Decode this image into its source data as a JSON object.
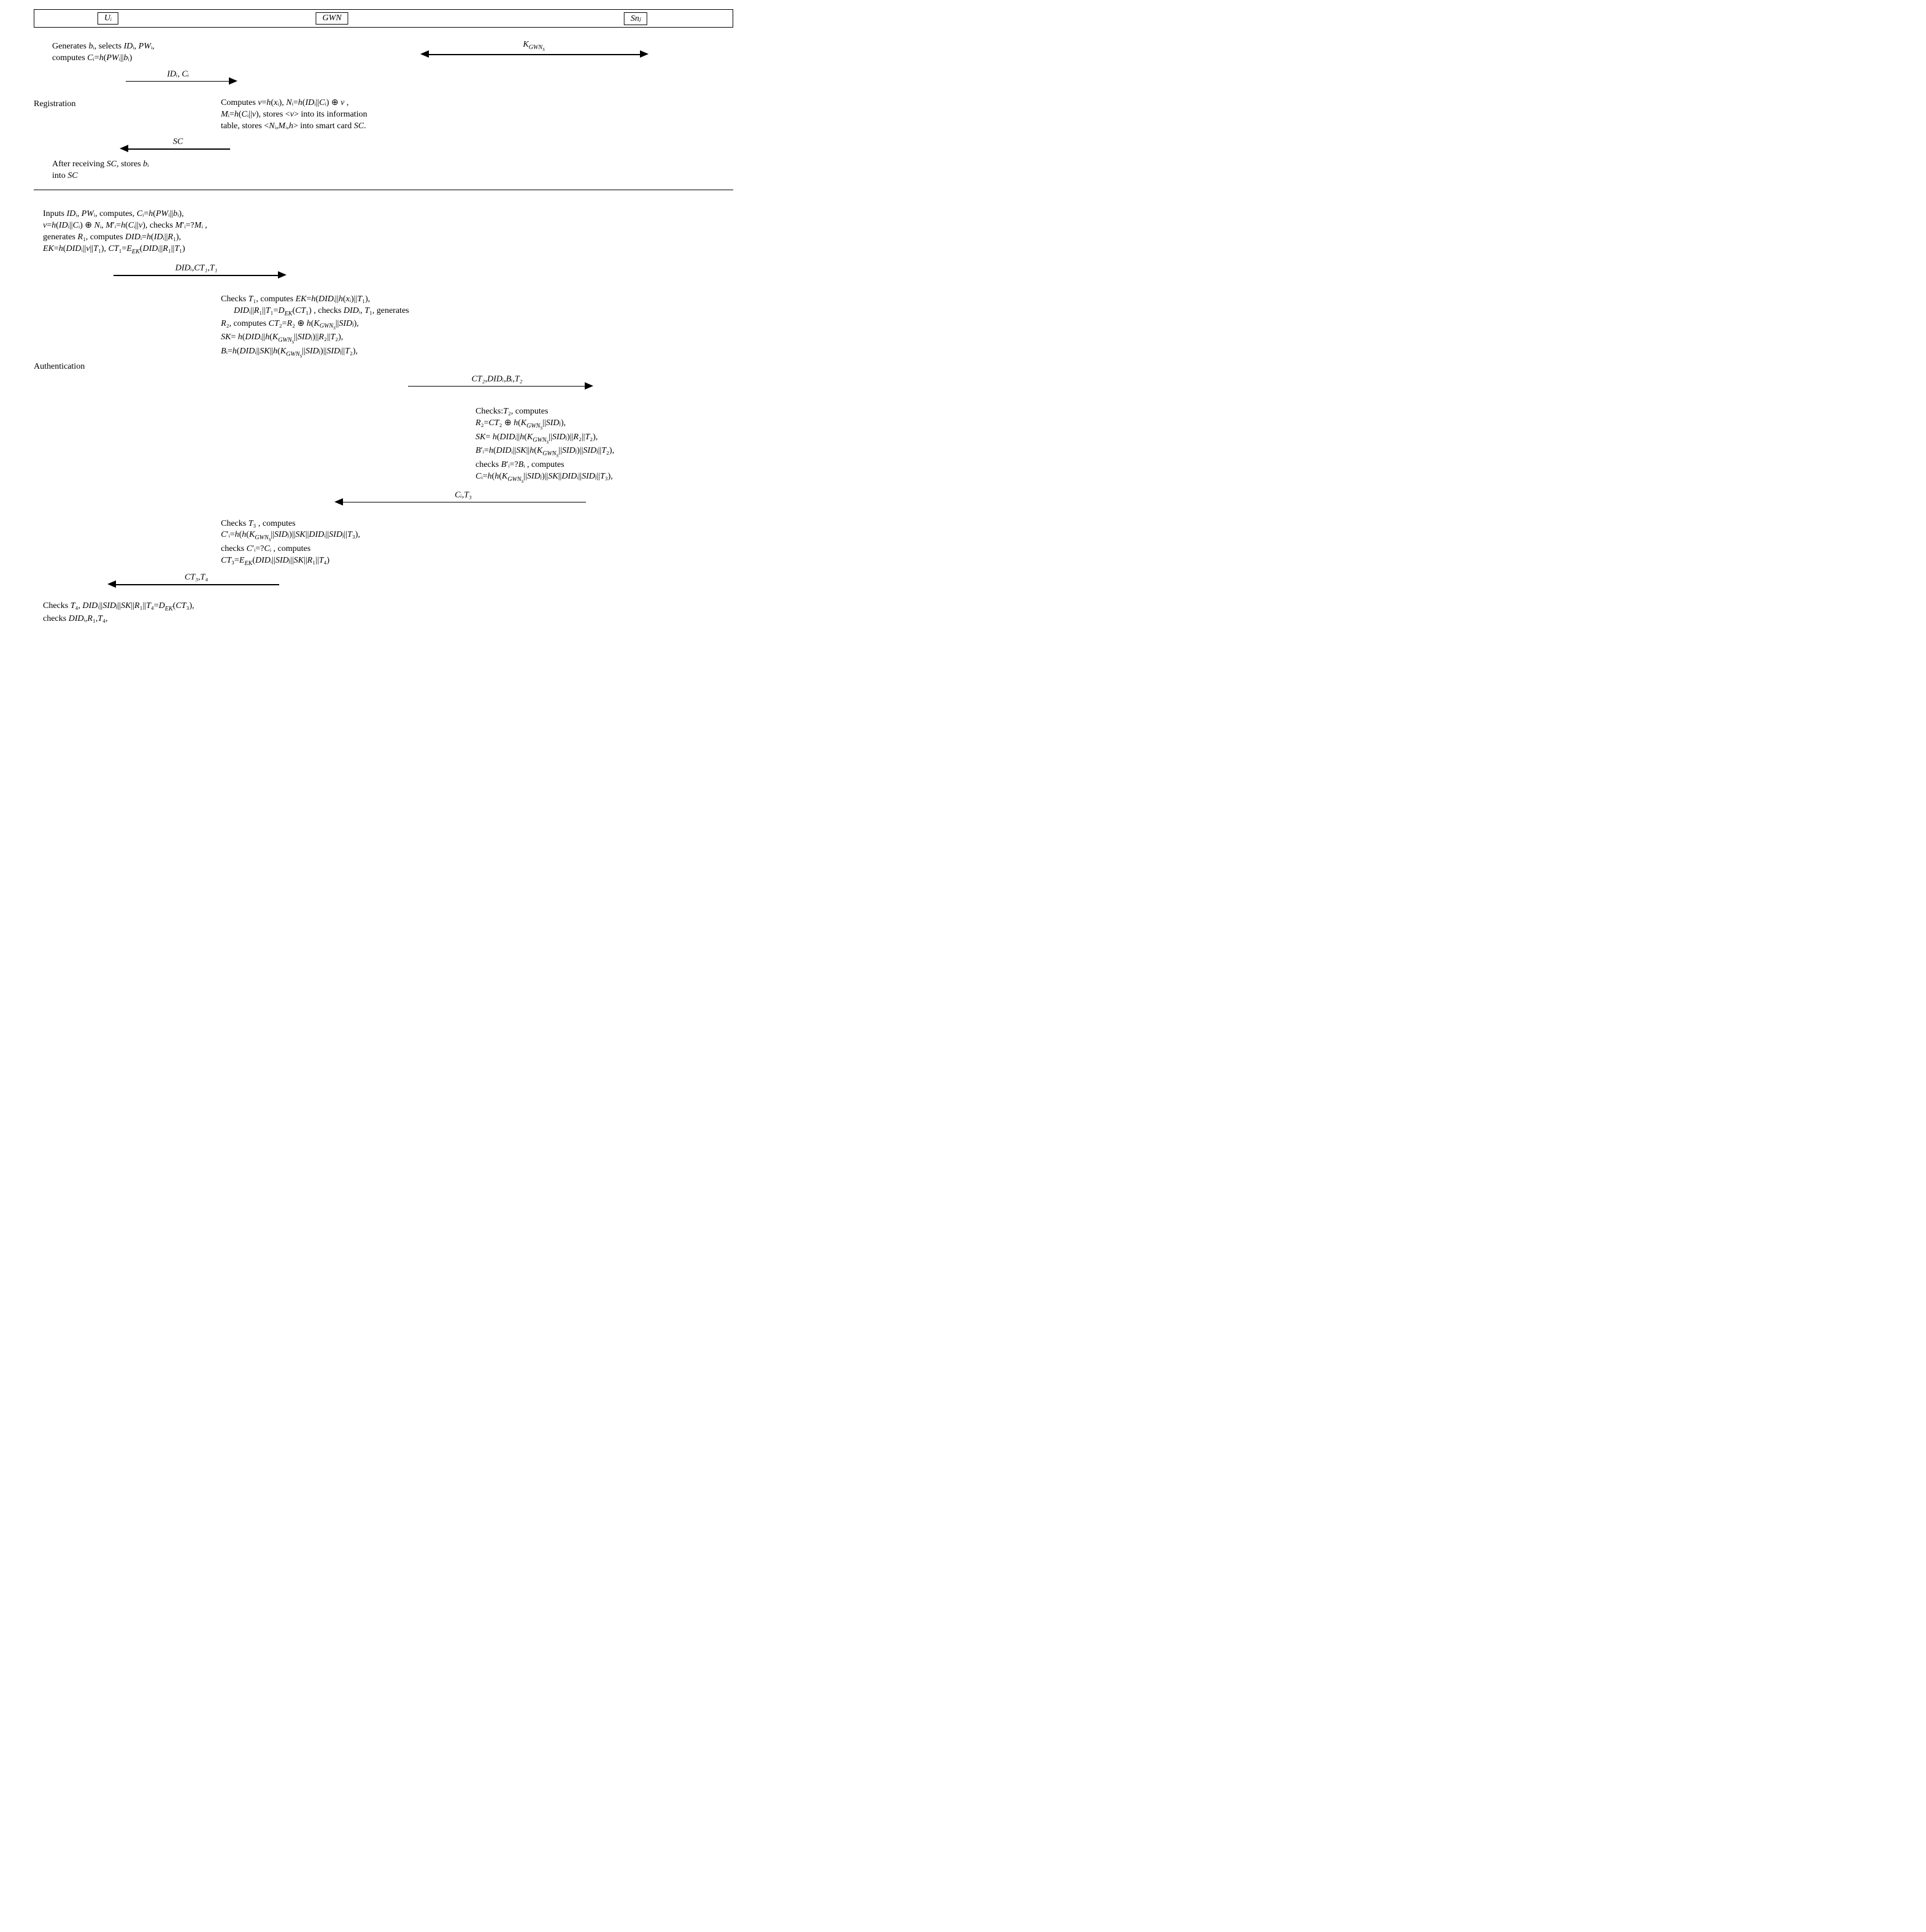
{
  "header": {
    "ui": "Uᵢ",
    "gwn": "GWN",
    "sn": "Snⱼ"
  },
  "phases": {
    "registration": "Registration",
    "authentication": "Authentication"
  },
  "reg": {
    "u_step1_l1": "Generates bᵢ, selects  IDᵢ, PWᵢ,",
    "u_step1_l2": "computes Cᵢ=h(PWᵢ||bᵢ)",
    "msg1": "IDᵢ, Cᵢ",
    "kgwns": "K_GWN_S",
    "gwn_l1": "Computes v=h(xᵢ), Nᵢ=h(IDᵢ||Cᵢ) ⊕ v ,",
    "gwn_l2": "Mᵢ=h(Cᵢ||v), stores <v> into its information",
    "gwn_l3": "table, stores <Nᵢ,Mᵢ,h> into smart card SC.",
    "msg2": "SC",
    "u_step2_l1": "After receiving SC, stores bᵢ",
    "u_step2_l2": "into SC"
  },
  "auth": {
    "u1_l1": "Inputs IDᵢ, PWᵢ,  computes, Cᵢ=h(PWᵢ||bᵢ),",
    "u1_l2": "v=h(IDᵢ||Cᵢ) ⊕ Nᵢ, M′ᵢ=h(Cᵢ||v), checks M′ᵢ=?Mᵢ ,",
    "u1_l3": "generates R₁, computes DIDᵢ=h(IDᵢ||R₁),",
    "u1_l4": "EK=h(DIDᵢ||v||T₁), CT₁=E_EK(DIDᵢ||R₁||T₁)",
    "msg1": "DIDᵢ,CT₁,T₁",
    "g1_l1": "Checks T₁,   computes EK=h(DIDᵢ||h(xᵢ)||T₁),",
    "g1_l2": "      DIDᵢ||R₁||T₁=D_EK(CT₁) , checks DIDᵢ, T₁, generates",
    "g1_l3": "R₂, computes  CT₂=R₂ ⊕ h(K_GWN_S||SIDⱼ),",
    "g1_l4": "SK= h(DIDᵢ||h(K_GWN_S||SIDⱼ)||R₂||T₂),",
    "g1_l5": "Bᵢ=h(DIDᵢ||SK||h(K_GWN_S||SIDⱼ)||SIDⱼ||T₂),",
    "msg2": "CT₂,DIDᵢ,Bᵢ,T₂",
    "s1_l1": "Checks:T₂, computes",
    "s1_l2": "R₂=CT₂ ⊕ h(K_GWN_S||SIDⱼ),",
    "s1_l3": "SK= h(DIDᵢ||h(K_GWN_S||SIDⱼ)||R₂||T₂),",
    "s1_l4": "B′ᵢ=h(DIDᵢ||SK||h(K_GWN_S||SIDⱼ)||SIDⱼ||T₂),",
    "s1_l5": "checks B′ᵢ=?Bᵢ , computes",
    "s1_l6": "Cᵢ=h(h(K_GWN_S||SIDⱼ)||SK||DIDᵢ||SIDⱼ||T₃),",
    "msg3": "Cᵢ,T₃",
    "g2_l1": "Checks T₃ , computes",
    "g2_l2": "C′ᵢ=h(h(K_GWN_S||SIDⱼ)||SK||DIDᵢ||SIDⱼ||T₃),",
    "g2_l3": "checks C′ᵢ=?Cᵢ , computes",
    "g2_l4": "CT₃=E_EK(DIDᵢ||SIDⱼ||SK||R₁||T₄)",
    "msg4": "CT₃,T₄",
    "u2_l1": "Checks  T₄, DIDᵢ||SIDⱼ||SK||R₁||T₄=D_EK(CT₃),",
    "u2_l2": "checks DIDᵢ,R₁,T₄,"
  },
  "chart_data": {
    "type": "sequence",
    "participants": [
      "Uᵢ",
      "GWN",
      "Snⱼ"
    ],
    "phases": [
      {
        "name": "Registration",
        "messages": [
          {
            "from": "Uᵢ",
            "to": "GWN",
            "label": "IDᵢ, Cᵢ"
          },
          {
            "from": "GWN",
            "to": "Snⱼ",
            "direction": "both",
            "label": "K_GWN_S"
          },
          {
            "from": "GWN",
            "to": "Uᵢ",
            "label": "SC"
          }
        ]
      },
      {
        "name": "Authentication",
        "messages": [
          {
            "from": "Uᵢ",
            "to": "GWN",
            "label": "DIDᵢ, CT₁, T₁"
          },
          {
            "from": "GWN",
            "to": "Snⱼ",
            "label": "CT₂, DIDᵢ, Bᵢ, T₂"
          },
          {
            "from": "Snⱼ",
            "to": "GWN",
            "label": "Cᵢ, T₃"
          },
          {
            "from": "GWN",
            "to": "Uᵢ",
            "label": "CT₃, T₄"
          }
        ]
      }
    ]
  }
}
